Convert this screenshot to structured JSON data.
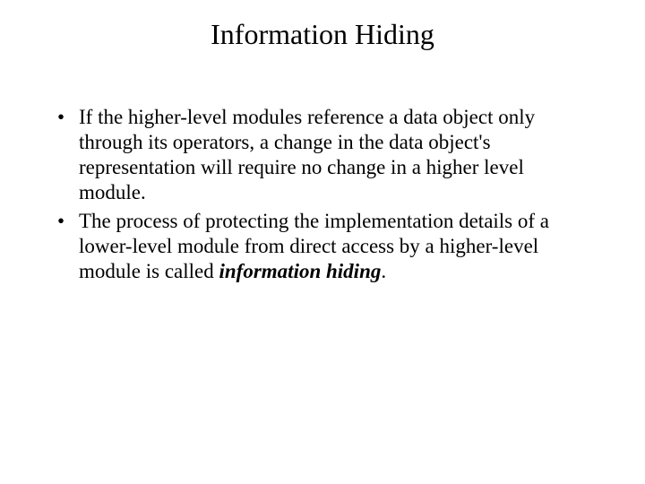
{
  "title": "Information Hiding",
  "bullets": [
    {
      "text": "If the higher-level modules reference a data object only through its operators, a change in the data object's representation will require no change in a higher level module."
    },
    {
      "prefix": "The process of protecting the implementation details of a lower-level module from direct access by a higher-level module is called ",
      "emph": "information hiding",
      "suffix": "."
    }
  ]
}
